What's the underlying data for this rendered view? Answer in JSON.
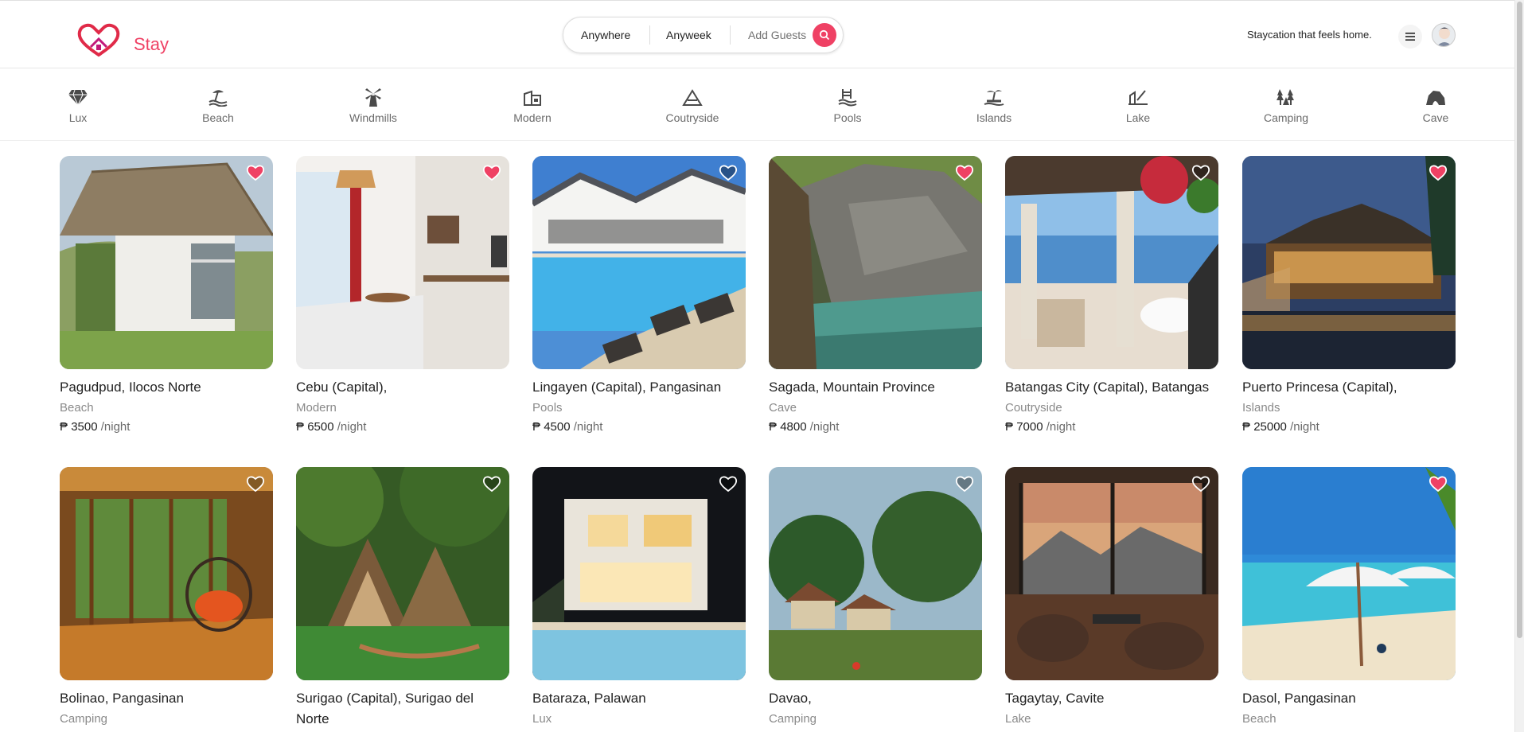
{
  "brand": {
    "name": "Stay",
    "color": "#ef4164",
    "logo_icon": "heart-house-logo-icon"
  },
  "search": {
    "where": "Anywhere",
    "when": "Anyweek",
    "guests": "Add Guests",
    "button_icon": "search-icon"
  },
  "header": {
    "tagline": "Staycation that feels home.",
    "menu_icon": "menu-icon",
    "avatar_icon": "user-avatar"
  },
  "categories": [
    {
      "label": "Lux",
      "icon": "diamond-icon"
    },
    {
      "label": "Beach",
      "icon": "beach-icon"
    },
    {
      "label": "Windmills",
      "icon": "windmill-icon"
    },
    {
      "label": "Modern",
      "icon": "modern-house-icon"
    },
    {
      "label": "Coutryside",
      "icon": "countryside-icon"
    },
    {
      "label": "Pools",
      "icon": "pool-icon"
    },
    {
      "label": "Islands",
      "icon": "island-icon"
    },
    {
      "label": "Lake",
      "icon": "lake-icon"
    },
    {
      "label": "Camping",
      "icon": "camping-icon"
    },
    {
      "label": "Cave",
      "icon": "cave-icon"
    }
  ],
  "listings": [
    {
      "title": "Pagudpud, Ilocos Norte",
      "type": "Beach",
      "currency": "₱",
      "price": "3500",
      "unit": "/night",
      "favorited": true,
      "image": "beach-hut"
    },
    {
      "title": "Cebu (Capital),",
      "type": "Modern",
      "currency": "₱",
      "price": "6500",
      "unit": "/night",
      "favorited": true,
      "image": "modern-room"
    },
    {
      "title": "Lingayen (Capital), Pangasinan",
      "type": "Pools",
      "currency": "₱",
      "price": "4500",
      "unit": "/night",
      "favorited": false,
      "image": "resort-pool"
    },
    {
      "title": "Sagada, Mountain Province",
      "type": "Cave",
      "currency": "₱",
      "price": "4800",
      "unit": "/night",
      "favorited": true,
      "image": "cave-lagoon"
    },
    {
      "title": "Batangas City (Capital), Batangas",
      "type": "Coutryside",
      "currency": "₱",
      "price": "7000",
      "unit": "/night",
      "favorited": false,
      "image": "sea-terrace"
    },
    {
      "title": "Puerto Princesa (Capital),",
      "type": "Islands",
      "currency": "₱",
      "price": "25000",
      "unit": "/night",
      "favorited": true,
      "image": "night-resort"
    },
    {
      "title": "Bolinao, Pangasinan",
      "type": "Camping",
      "currency": "",
      "price": "",
      "unit": "",
      "favorited": false,
      "image": "wooden-veranda"
    },
    {
      "title": "Surigao (Capital), Surigao del Norte",
      "type": "",
      "currency": "",
      "price": "",
      "unit": "",
      "favorited": false,
      "image": "a-frame-cabin"
    },
    {
      "title": "Bataraza, Palawan",
      "type": "Lux",
      "currency": "",
      "price": "",
      "unit": "",
      "favorited": false,
      "image": "night-villa-pool"
    },
    {
      "title": "Davao,",
      "type": "Camping",
      "currency": "",
      "price": "",
      "unit": "",
      "favorited": false,
      "image": "forest-houses"
    },
    {
      "title": "Tagaytay, Cavite",
      "type": "Lake",
      "currency": "",
      "price": "",
      "unit": "",
      "favorited": false,
      "image": "mountain-view-lounge"
    },
    {
      "title": "Dasol, Pangasinan",
      "type": "Beach",
      "currency": "",
      "price": "",
      "unit": "",
      "favorited": true,
      "image": "umbrella-beach"
    }
  ]
}
